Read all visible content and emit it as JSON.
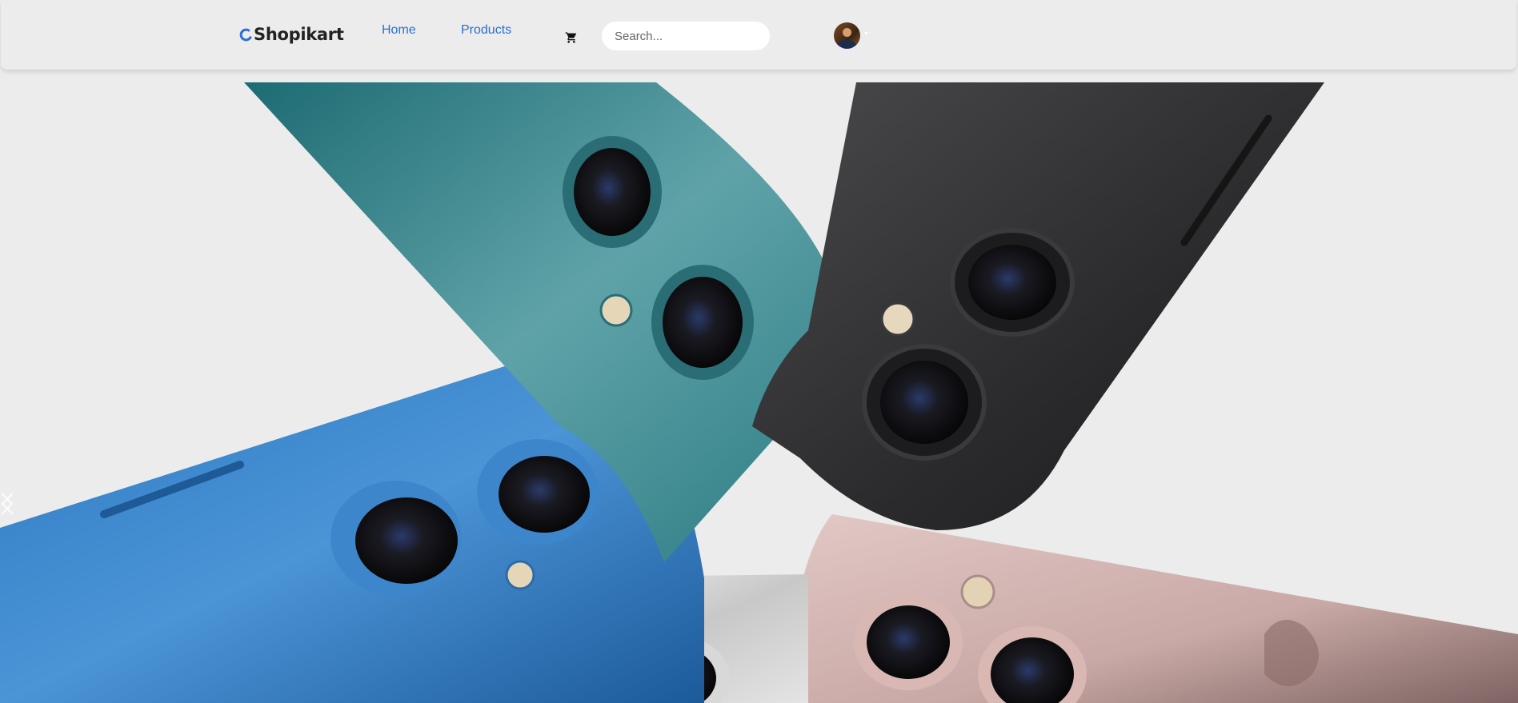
{
  "brand": {
    "name": "Shopikart",
    "accent": "#2a6fd6"
  },
  "nav": {
    "home_label": "Home",
    "products_label": "Products"
  },
  "icons": {
    "cart": "shopping-cart-icon",
    "carousel_prev": "chevron-left-icon",
    "carousel_next": "chevron-right-icon"
  },
  "search": {
    "placeholder": "Search..."
  },
  "user": {
    "avatar": "user-avatar"
  },
  "hero": {
    "image": "iPhone colour lineup – teal, black, blue, silver and pink backs with dual cameras"
  }
}
